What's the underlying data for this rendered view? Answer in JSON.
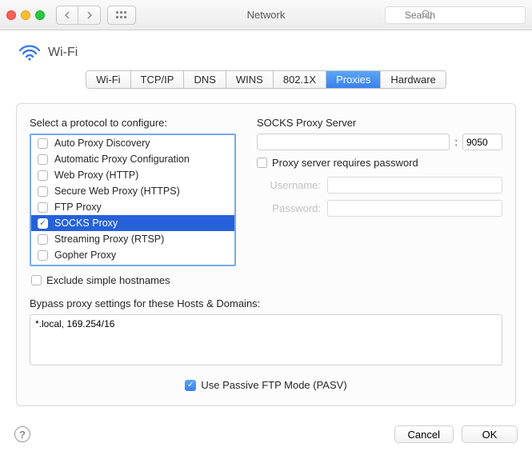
{
  "window": {
    "title": "Network"
  },
  "search": {
    "placeholder": "Search"
  },
  "header": {
    "wifi_label": "Wi-Fi"
  },
  "tabs": [
    {
      "label": "Wi-Fi",
      "active": false
    },
    {
      "label": "TCP/IP",
      "active": false
    },
    {
      "label": "DNS",
      "active": false
    },
    {
      "label": "WINS",
      "active": false
    },
    {
      "label": "802.1X",
      "active": false
    },
    {
      "label": "Proxies",
      "active": true
    },
    {
      "label": "Hardware",
      "active": false
    }
  ],
  "left": {
    "select_label": "Select a protocol to configure:",
    "protocols": [
      {
        "label": "Auto Proxy Discovery",
        "checked": false,
        "selected": false
      },
      {
        "label": "Automatic Proxy Configuration",
        "checked": false,
        "selected": false
      },
      {
        "label": "Web Proxy (HTTP)",
        "checked": false,
        "selected": false
      },
      {
        "label": "Secure Web Proxy (HTTPS)",
        "checked": false,
        "selected": false
      },
      {
        "label": "FTP Proxy",
        "checked": false,
        "selected": false
      },
      {
        "label": "SOCKS Proxy",
        "checked": true,
        "selected": true
      },
      {
        "label": "Streaming Proxy (RTSP)",
        "checked": false,
        "selected": false
      },
      {
        "label": "Gopher Proxy",
        "checked": false,
        "selected": false
      }
    ],
    "exclude_label": "Exclude simple hostnames",
    "exclude_checked": false
  },
  "right": {
    "server_label": "SOCKS Proxy Server",
    "addr": "",
    "port": "9050",
    "colon": ":",
    "requires_pw_label": "Proxy server requires password",
    "requires_pw_checked": false,
    "username_label": "Username:",
    "password_label": "Password:"
  },
  "bypass": {
    "label": "Bypass proxy settings for these Hosts & Domains:",
    "value": "*.local, 169.254/16"
  },
  "pasv": {
    "label": "Use Passive FTP Mode (PASV)",
    "checked": true
  },
  "footer": {
    "cancel": "Cancel",
    "ok": "OK"
  }
}
